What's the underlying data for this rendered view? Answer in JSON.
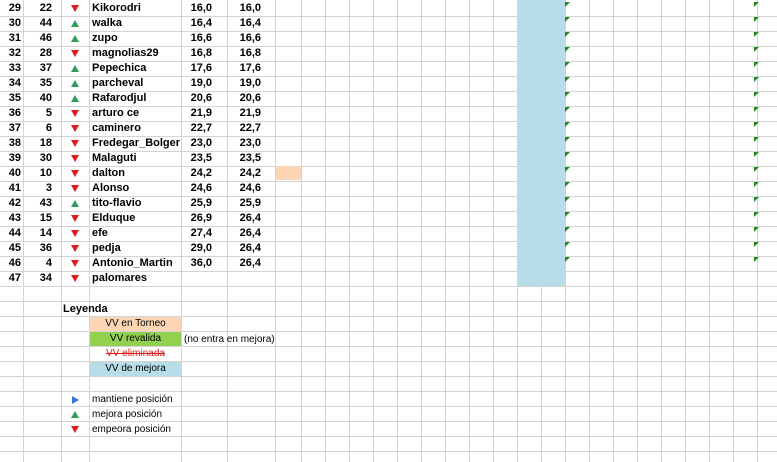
{
  "rows": [
    {
      "pos": "29",
      "prev": "22",
      "trend": "down",
      "name": "Kikorodri",
      "v1": "16,0",
      "v2": "16,0"
    },
    {
      "pos": "30",
      "prev": "44",
      "trend": "up",
      "name": "walka",
      "v1": "16,4",
      "v2": "16,4"
    },
    {
      "pos": "31",
      "prev": "46",
      "trend": "up",
      "name": "zupo",
      "v1": "16,6",
      "v2": "16,6"
    },
    {
      "pos": "32",
      "prev": "28",
      "trend": "down",
      "name": "magnolias29",
      "v1": "16,8",
      "v2": "16,8"
    },
    {
      "pos": "33",
      "prev": "37",
      "trend": "up",
      "name": "Pepechica",
      "v1": "17,6",
      "v2": "17,6"
    },
    {
      "pos": "34",
      "prev": "35",
      "trend": "up",
      "name": "parcheval",
      "v1": "19,0",
      "v2": "19,0"
    },
    {
      "pos": "35",
      "prev": "40",
      "trend": "up",
      "name": "Rafarodjul",
      "v1": "20,6",
      "v2": "20,6"
    },
    {
      "pos": "36",
      "prev": "5",
      "trend": "down",
      "name": "arturo ce",
      "v1": "21,9",
      "v2": "21,9"
    },
    {
      "pos": "37",
      "prev": "6",
      "trend": "down",
      "name": "caminero",
      "v1": "22,7",
      "v2": "22,7"
    },
    {
      "pos": "38",
      "prev": "18",
      "trend": "down",
      "name": "Fredegar_Bolger",
      "v1": "23,0",
      "v2": "23,0"
    },
    {
      "pos": "39",
      "prev": "30",
      "trend": "down",
      "name": "Malaguti",
      "v1": "23,5",
      "v2": "23,5"
    },
    {
      "pos": "40",
      "prev": "10",
      "trend": "down",
      "name": "dalton",
      "v1": "24,2",
      "v2": "24,2"
    },
    {
      "pos": "41",
      "prev": "3",
      "trend": "down",
      "name": "Alonso",
      "v1": "24,6",
      "v2": "24,6"
    },
    {
      "pos": "42",
      "prev": "43",
      "trend": "up",
      "name": "tito-flavio",
      "v1": "25,9",
      "v2": "25,9"
    },
    {
      "pos": "43",
      "prev": "15",
      "trend": "down",
      "name": "Elduque",
      "v1": "26,9",
      "v2": "26,4"
    },
    {
      "pos": "44",
      "prev": "14",
      "trend": "down",
      "name": "efe",
      "v1": "27,4",
      "v2": "26,4"
    },
    {
      "pos": "45",
      "prev": "36",
      "trend": "down",
      "name": "pedja",
      "v1": "29,0",
      "v2": "26,4"
    },
    {
      "pos": "46",
      "prev": "4",
      "trend": "down",
      "name": "Antonio_Martin",
      "v1": "36,0",
      "v2": "26,4"
    },
    {
      "pos": "47",
      "prev": "34",
      "trend": "down",
      "name": "palomares",
      "v1": "",
      "v2": ""
    }
  ],
  "legend": {
    "title": "Leyenda",
    "items": [
      {
        "label": "VV en Torneo",
        "color": "#fcd5b4",
        "note": "",
        "strike": false
      },
      {
        "label": "VV revalida",
        "color": "#92d050",
        "note": "(no entra en mejora)",
        "strike": false
      },
      {
        "label": "VV eliminada",
        "color": "#ffffff",
        "note": "",
        "strike": true
      },
      {
        "label": "VV de mejora",
        "color": "#b7dde8",
        "note": "",
        "strike": false
      }
    ],
    "symbols": [
      {
        "shape": "right",
        "label": "mantiene posición"
      },
      {
        "shape": "up",
        "label": "mejora posición"
      },
      {
        "shape": "down",
        "label": "empeora posición"
      }
    ]
  },
  "colors": {
    "grid": "#d4d4d4",
    "trend_up": "#2e9e5b",
    "trend_down": "#e01b1b",
    "trend_same": "#3a6fd8",
    "mejora_column": "#b7dde8",
    "torneo_cell": "#fcd5b4",
    "comment_marker": "#1e8c1e"
  }
}
